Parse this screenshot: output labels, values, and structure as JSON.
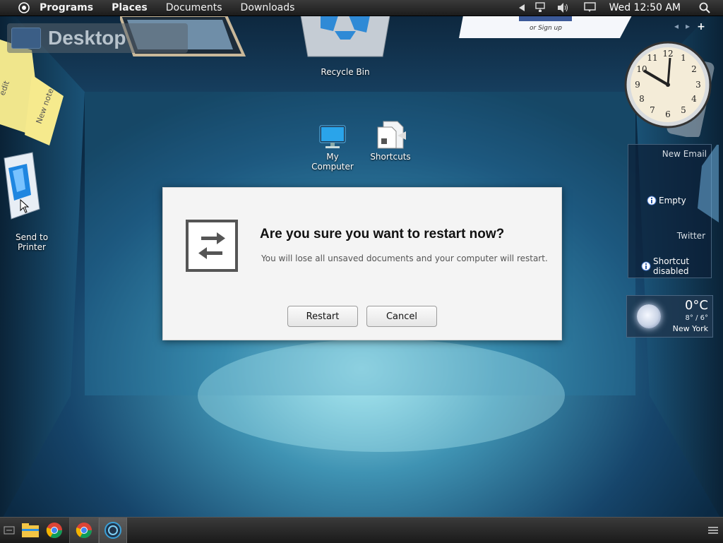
{
  "topbar": {
    "menu": [
      "Programs",
      "Places",
      "Documents",
      "Downloads"
    ],
    "clock": "Wed 12:50 AM"
  },
  "desktop_label": "Desktop",
  "desktop_icons": {
    "recycle_bin": "Recycle Bin",
    "my_computer": [
      "My",
      "Computer"
    ],
    "shortcuts": "Shortcuts",
    "send_to_printer": [
      "Send to",
      "Printer"
    ]
  },
  "sticky_notes": [
    "edit",
    "New note"
  ],
  "signup_card": {
    "text": "or Sign up"
  },
  "dialog": {
    "title": "Are you sure you want to restart now?",
    "message": "You will lose all unsaved documents and your computer will restart.",
    "restart_label": "Restart",
    "cancel_label": "Cancel"
  },
  "notifications": {
    "new_email": "New Email",
    "empty": "Empty",
    "twitter": "Twitter",
    "shortcut_disabled": [
      "Shortcut",
      "disabled"
    ]
  },
  "weather": {
    "temp": "0°C",
    "range": "8° / 6°",
    "city": "New York"
  },
  "clock_gadget": {
    "hour": 12,
    "minute": 50
  },
  "colors": {
    "dialog_bg": "#f4f4f4",
    "topbar_bg": "#2a2a2a",
    "room_glow": "#7fd4e6"
  }
}
